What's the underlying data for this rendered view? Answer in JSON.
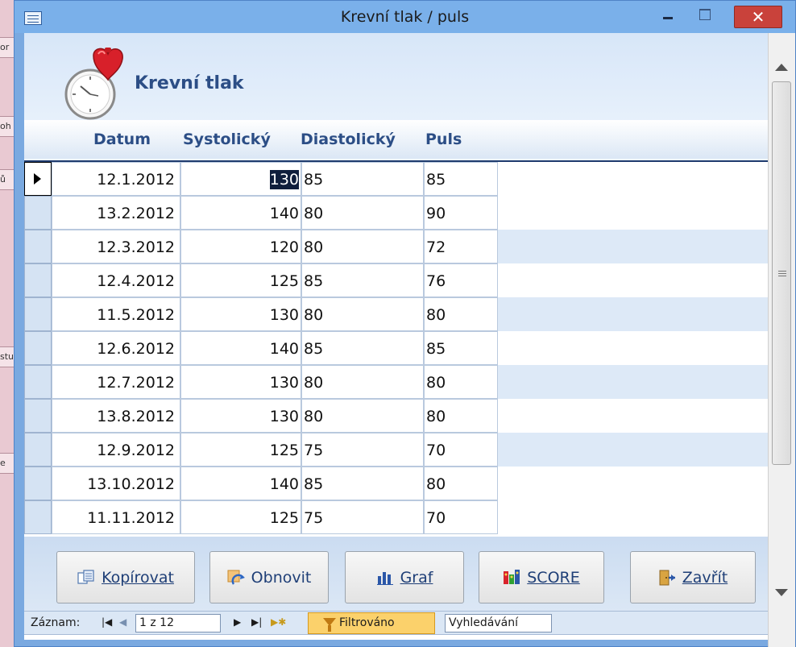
{
  "window": {
    "title": "Krevní tlak / puls",
    "close_glyph": "✕"
  },
  "form": {
    "title": "Krevní tlak",
    "logo_icon": "stopwatch-heart-icon"
  },
  "columns": {
    "datum": "Datum",
    "systolicky": "Systolický",
    "diastolicky": "Diastolický",
    "puls": "Puls"
  },
  "records": [
    {
      "datum": "12.1.2012",
      "systolicky": "130",
      "diastolicky": "85",
      "puls": "85"
    },
    {
      "datum": "13.2.2012",
      "systolicky": "140",
      "diastolicky": "80",
      "puls": "90"
    },
    {
      "datum": "12.3.2012",
      "systolicky": "120",
      "diastolicky": "80",
      "puls": "72"
    },
    {
      "datum": "12.4.2012",
      "systolicky": "125",
      "diastolicky": "85",
      "puls": "76"
    },
    {
      "datum": "11.5.2012",
      "systolicky": "130",
      "diastolicky": "80",
      "puls": "80"
    },
    {
      "datum": "12.6.2012",
      "systolicky": "140",
      "diastolicky": "85",
      "puls": "85"
    },
    {
      "datum": "12.7.2012",
      "systolicky": "130",
      "diastolicky": "80",
      "puls": "80"
    },
    {
      "datum": "13.8.2012",
      "systolicky": "130",
      "diastolicky": "80",
      "puls": "80"
    },
    {
      "datum": "12.9.2012",
      "systolicky": "125",
      "diastolicky": "75",
      "puls": "70"
    },
    {
      "datum": "13.10.2012",
      "systolicky": "140",
      "diastolicky": "85",
      "puls": "80"
    },
    {
      "datum": "11.11.2012",
      "systolicky": "125",
      "diastolicky": "75",
      "puls": "70"
    }
  ],
  "buttons": {
    "kopirovat": {
      "label": "Kopírovat",
      "icon": "copy-icon"
    },
    "obnovit": {
      "label": "Obnovit",
      "icon": "refresh-icon"
    },
    "graf": {
      "label": "Graf",
      "icon": "bar-chart-icon"
    },
    "score": {
      "label": "SCORE",
      "icon": "score-icon"
    },
    "zavrit": {
      "label": "Zavřít",
      "icon": "exit-door-icon"
    }
  },
  "navigation": {
    "label": "Záznam:",
    "position": "1 z 12",
    "filter_status": "Filtrováno",
    "search_placeholder": "Vyhledávání"
  },
  "background": {
    "fragments": [
      "or",
      "oh",
      "ů",
      "stu",
      "e"
    ]
  }
}
